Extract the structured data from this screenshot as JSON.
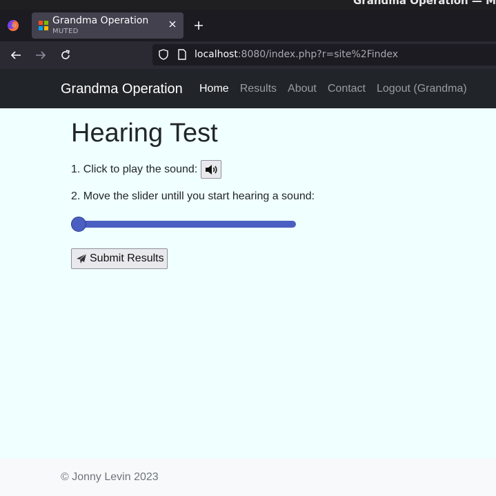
{
  "os": {
    "window_title": "Grandma Operation — Mozi"
  },
  "browser": {
    "tab": {
      "title": "Grandma Operation",
      "subtitle": "MUTED"
    },
    "url_host": "localhost",
    "url_rest": ":8080/index.php?r=site%2Findex",
    "icons": [
      "firefox-logo",
      "close-icon",
      "plus-icon",
      "back-arrow-icon",
      "forward-arrow-icon",
      "reload-icon",
      "shield-icon",
      "page-icon"
    ]
  },
  "site": {
    "brand": "Grandma Operation",
    "nav": [
      {
        "label": "Home",
        "active": true
      },
      {
        "label": "Results"
      },
      {
        "label": "About"
      },
      {
        "label": "Contact"
      },
      {
        "label": "Logout (Grandma)"
      }
    ]
  },
  "main": {
    "title": "Hearing Test",
    "step1": "1. Click to play the sound:",
    "step2": "2. Move the slider untill you start hearing a sound:",
    "slider_value": 0,
    "submit_label": "Submit Results"
  },
  "footer": {
    "text": "© Jonny Levin 2023"
  },
  "colors": {
    "accent": "#4a5fc1",
    "nav_bg": "#212529",
    "page_bg": "#f0ffff"
  }
}
